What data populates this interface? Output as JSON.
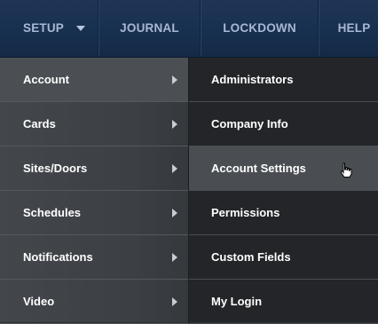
{
  "nav": {
    "setup": "SETUP",
    "journal": "JOURNAL",
    "lockdown": "LOCKDOWN",
    "help": "HELP"
  },
  "submenu": {
    "items": [
      "Account",
      "Cards",
      "Sites/Doors",
      "Schedules",
      "Notifications",
      "Video"
    ],
    "active": "Account"
  },
  "account_menu": {
    "items": [
      "Administrators",
      "Company Info",
      "Account Settings",
      "Permissions",
      "Custom Fields",
      "My Login"
    ],
    "hovered": "Account Settings"
  },
  "icons": {
    "setup_caret": "chevron-down-icon",
    "submenu_arrow": "chevron-right-icon",
    "cursor": "hand-pointer-icon"
  },
  "colors": {
    "topbar": "#18304f",
    "nav_text": "#a7b8d4",
    "menu_bg": "#3c4045",
    "submenu_bg": "#232528"
  }
}
